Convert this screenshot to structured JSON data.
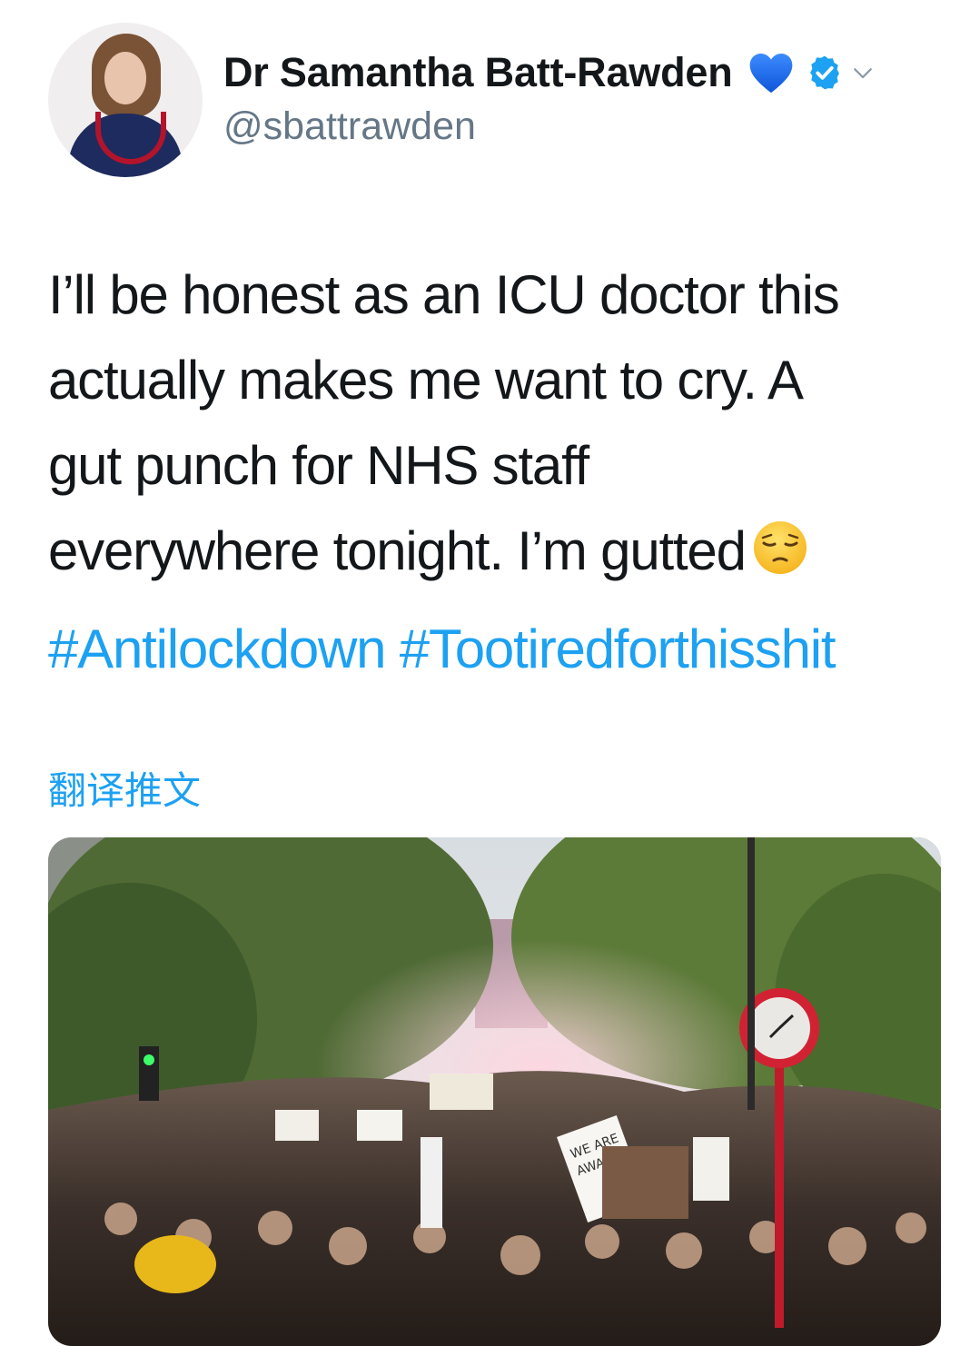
{
  "author": {
    "name": "Dr Samantha Batt-Rawden",
    "handle": "@sbattrawden",
    "name_emoji": "blue-heart-icon",
    "verified_icon": "verified-badge-icon",
    "menu_icon": "chevron-down-icon"
  },
  "tweet": {
    "lines": [
      "I’ll be honest as an ICU doctor this",
      "actually makes me want to cry. A",
      "gut punch for NHS staff",
      "everywhere tonight. I’m gutted"
    ],
    "trailing_emoji": "pensive-face-icon",
    "hashtags": [
      "#Antilockdown",
      "#Tootiredforthisshit"
    ],
    "translate_label": "翻译推文"
  },
  "media": {
    "kind": "protest-crowd-photo",
    "sign_text": "WE ARE AWARE"
  },
  "colors": {
    "link": "#1da1f2",
    "text": "#14171a",
    "secondary": "#657786",
    "verified": "#1da1f2",
    "heart": "#1f6fe5"
  }
}
